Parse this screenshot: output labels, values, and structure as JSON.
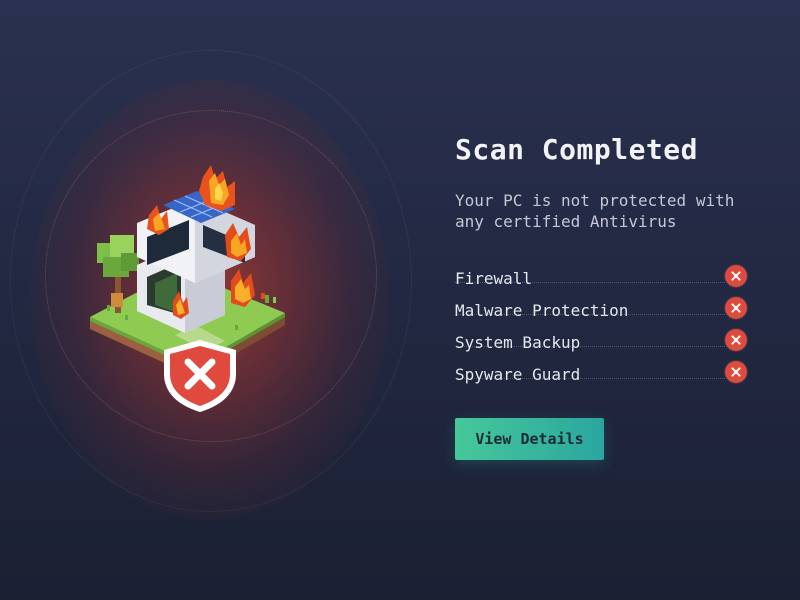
{
  "scan": {
    "title": "Scan Completed",
    "subtitle": "Your PC is not protected with any certified Antivirus"
  },
  "checks": [
    {
      "label": "Firewall",
      "status_icon": "x-circle-icon"
    },
    {
      "label": "Malware Protection",
      "status_icon": "x-circle-icon"
    },
    {
      "label": "System Backup",
      "status_icon": "x-circle-icon"
    },
    {
      "label": "Spyware Guard",
      "status_icon": "x-circle-icon"
    }
  ],
  "actions": {
    "view_details_label": "View Details"
  },
  "illustration": {
    "subject": "burning-house-icon",
    "badge": "shield-x-icon"
  },
  "colors": {
    "background": "#242a44",
    "alert_red": "#e0493d",
    "button_start": "#46c89a",
    "button_end": "#2aa6a0",
    "title_text": "#f2f3f6",
    "body_text": "#c4c8d4"
  }
}
